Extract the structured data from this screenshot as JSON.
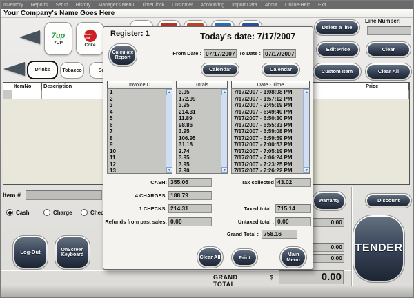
{
  "icons": {
    "up": "▲",
    "down": "▼"
  },
  "colors": {
    "button_dark": "#39455a",
    "list_bg": "#c6c6c2",
    "table_body": "#e9e7d9",
    "scrollbar_track": "#cfdef2",
    "scrollbar_arrow": "#3f6fb5",
    "logo_7up_green": "#2e9e46",
    "logo_coke_red": "#cc2127",
    "partial_product_colors": [
      "#ffffff",
      "#b3352b",
      "#c0452a",
      "#2f6cb3",
      "#2f4f9e"
    ]
  },
  "menu": {
    "items": [
      "Inventory",
      "Reports",
      "Setup",
      "History",
      "Manager's Menu",
      "TimeClock",
      "Customer",
      "Accounting",
      "Import Data",
      "About",
      "Online-Help",
      "Exit"
    ]
  },
  "titlebar": {
    "company": "Your Company's Name Goes Here"
  },
  "catalog": {
    "products": [
      {
        "label": "7UP",
        "logo_text": "7up"
      },
      {
        "label": "Coke",
        "logo_text": "Coca-Cola"
      }
    ],
    "tabs": [
      {
        "label": "Drinks",
        "selected": true
      },
      {
        "label": "Tobacco",
        "selected": false
      },
      {
        "label": "Se",
        "selected": false
      }
    ]
  },
  "sales_grid": {
    "headers": [
      "ItemNo",
      "Description",
      "Price"
    ]
  },
  "right_panel": {
    "delete_line": "Delete a line",
    "line_number_label": "Line Number:",
    "line_number_value": "",
    "edit_price": "Edit Price",
    "clear": "Clear",
    "custom_item": "Custom Item",
    "clear_all": "Clear All",
    "warranty": "Warranty",
    "discount": "Discount",
    "amount_fields": [
      "0.00",
      "0.00",
      "0.00"
    ],
    "tender": "TENDER"
  },
  "bottom_panel": {
    "item_label": "Item #",
    "item_value": "",
    "payments": [
      {
        "label": "Cash",
        "selected": true
      },
      {
        "label": "Charge",
        "selected": false
      },
      {
        "label": "Check",
        "selected": false
      }
    ],
    "logout": "Log-Out",
    "keyboard": "OnScreen Keyboard",
    "grand_total_label": "GRAND TOTAL",
    "currency": "$",
    "grand_total_value": "0.00"
  },
  "dialog": {
    "register": "Register: 1",
    "todays_date": "Today's date: 7/17/2007",
    "calculate_report": "Calculate Report",
    "from_label": "From Date :",
    "from_value": "07/17/2007",
    "to_label": "To Date :",
    "to_value": "07/17/2007",
    "calendar": "Calendar",
    "invoices": {
      "headers": [
        "InvoiceID",
        "Totals",
        "Date - Time"
      ],
      "ids": [
        "1",
        "2",
        "3",
        "4",
        "5",
        "6",
        "7",
        "8",
        "9",
        "10",
        "11",
        "12",
        "13"
      ],
      "totals": [
        "3.95",
        "172.99",
        "3.95",
        "214.31",
        "11.89",
        "98.86",
        "3.95",
        "106.95",
        "31.18",
        "2.74",
        "3.95",
        "3.95",
        "7.90"
      ],
      "datetimes": [
        "7/17/2007 - 1:08:08 PM",
        "7/17/2007 - 1:57:12 PM",
        "7/17/2007 - 2:45:19 PM",
        "7/17/2007 - 6:49:40 PM",
        "7/17/2007 - 6:50:30 PM",
        "7/17/2007 - 6:55:33 PM",
        "7/17/2007 - 6:59:08 PM",
        "7/17/2007 - 6:59:59 PM",
        "7/17/2007 - 7:00:53 PM",
        "7/17/2007 - 7:05:19 PM",
        "7/17/2007 - 7:06:24 PM",
        "7/17/2007 - 7:23:25 PM",
        "7/17/2007 - 7:26:22 PM"
      ]
    },
    "summary_left": [
      {
        "label": "CASH:",
        "value": "355.06"
      },
      {
        "label": "4 CHARGES:",
        "value": "188.79"
      },
      {
        "label": "1 CHECKS:",
        "value": "214.31"
      },
      {
        "label": "Refunds from past sales:",
        "value": "0.00"
      }
    ],
    "summary_right": [
      {
        "label": "Tax collected",
        "value": "43.02"
      },
      {
        "label": "Taxed total :",
        "value": "715.14"
      },
      {
        "label": "Untaxed total :",
        "value": "0.00"
      },
      {
        "label": "Grand Total :",
        "value": "758.16"
      }
    ],
    "buttons": {
      "clear_all": "Clear All",
      "print": "Print",
      "main_menu": "Main Menu"
    }
  }
}
